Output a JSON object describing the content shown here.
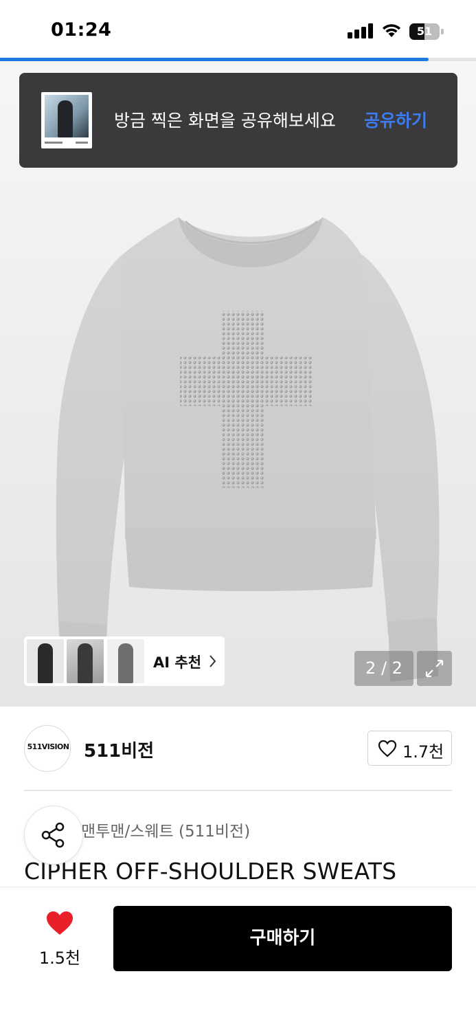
{
  "status_bar": {
    "time": "01:24",
    "battery_level": "51",
    "battery_fraction": 0.51
  },
  "image_progress": {
    "fraction": 0.9
  },
  "toast": {
    "message": "방금 찍은 화면을 공유해보세요",
    "action_label": "공유하기"
  },
  "gallery": {
    "ai_recommend_label": "AI 추천",
    "counter": "2 / 2"
  },
  "brand": {
    "logo_text": "511VISION",
    "name": "511비전",
    "like_count": "1.7천"
  },
  "product": {
    "category": "맨투맨/스웨트 (511비전)",
    "title": "CIPHER OFF-SHOULDER SWEATS"
  },
  "bottom_bar": {
    "like_count": "1.5천",
    "buy_label": "구매하기"
  },
  "colors": {
    "accent_blue": "#3d7cf0",
    "progress_blue": "#1f7ae0",
    "heart_red": "#e8202a",
    "buy_button": "#000000"
  }
}
